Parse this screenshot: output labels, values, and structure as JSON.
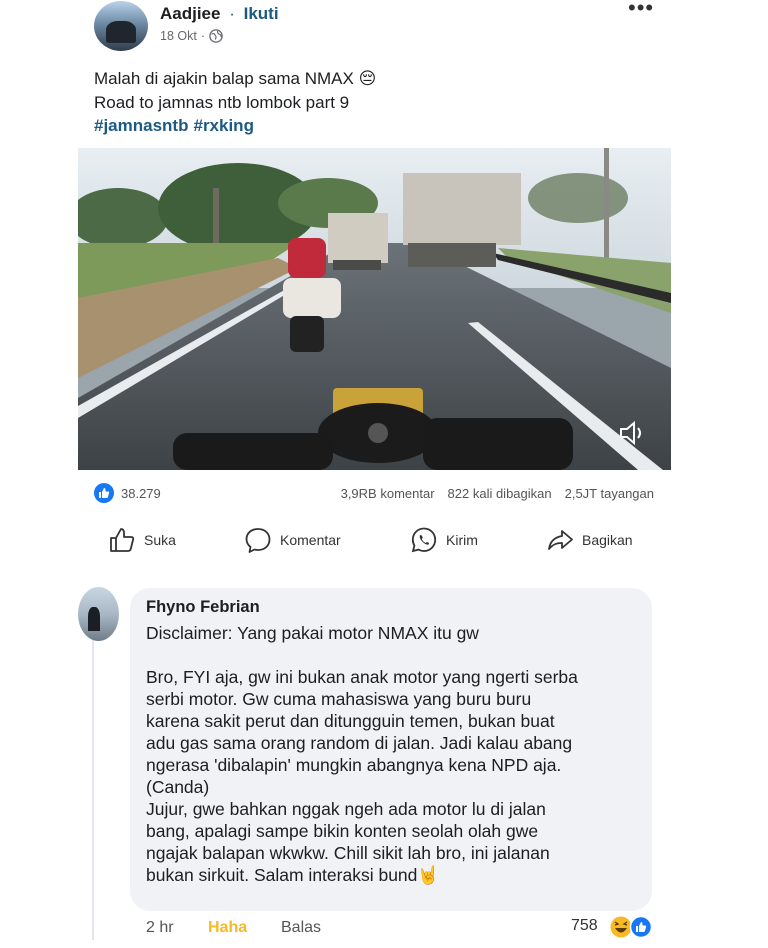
{
  "post": {
    "author": "Aadjiee",
    "separator": "·",
    "follow_label": "Ikuti",
    "date": "18 Okt",
    "more": "•••",
    "caption_line1": "Malah di ajakin balap sama NMAX 😔",
    "caption_line2": "Road to jamnas ntb lombok part 9",
    "hashtags": [
      "#jamnasntb",
      "#rxking"
    ]
  },
  "stats": {
    "likes": "38.279",
    "comments": "3,9RB komentar",
    "shares": "822 kali dibagikan",
    "views": "2,5JT tayangan"
  },
  "actions": {
    "like": "Suka",
    "comment": "Komentar",
    "send": "Kirim",
    "share": "Bagikan"
  },
  "comment": {
    "author": "Fhyno Febrian",
    "line1": "Disclaimer: Yang pakai motor NMAX itu gw",
    "para2": "Bro, FYI aja, gw ini bukan anak motor yang ngerti serba\nserbi motor. Gw cuma mahasiswa yang buru buru\nkarena sakit perut dan ditungguin temen, bukan buat\nadu gas sama orang random di jalan. Jadi kalau abang\nngerasa 'dibalapin' mungkin abangnya kena NPD aja.\n(Canda)\nJujur, gwe bahkan nggak ngeh ada motor lu di jalan\nbang, apalagi sampe bikin konten seolah olah gwe\nngajak balapan wkwkw. Chill sikit lah bro, ini jalanan\nbukan sirkuit. Salam interaksi bund🤘",
    "time": "2 hr",
    "haha_label": "Haha",
    "reply_label": "Balas",
    "reaction_count": "758"
  },
  "colors": {
    "link": "#1c5a82",
    "like_blue": "#1877f2",
    "haha_yellow": "#f7b928",
    "bubble": "#f0f2f5"
  }
}
